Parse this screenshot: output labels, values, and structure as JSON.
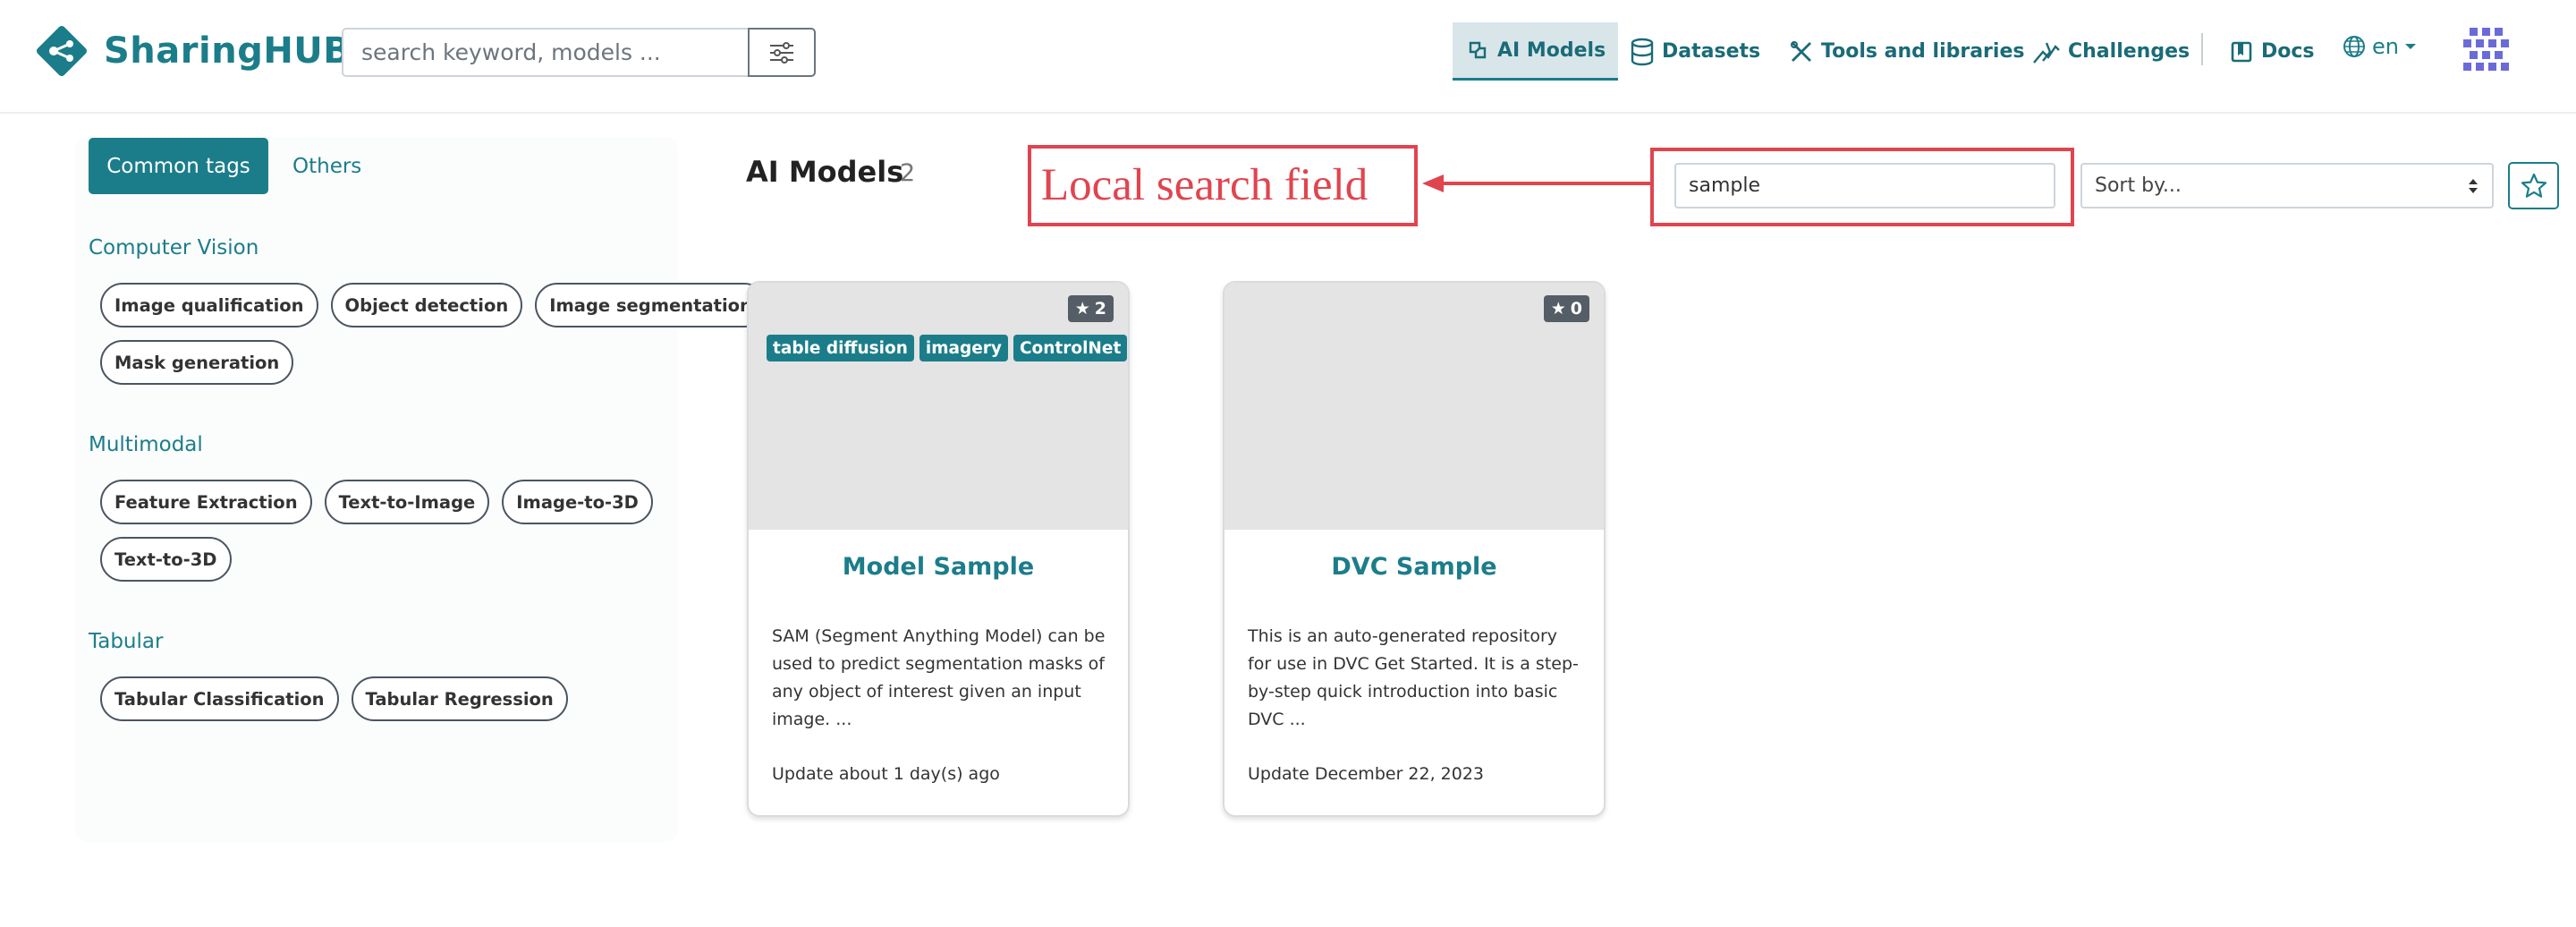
{
  "header": {
    "brand": "SharingHUB",
    "search_placeholder": "search keyword, models ...",
    "nav": {
      "ai_models": "AI Models",
      "datasets": "Datasets",
      "tools": "Tools and libraries",
      "challenges": "Challenges",
      "docs": "Docs"
    },
    "language": "en"
  },
  "sidebar": {
    "tabs": {
      "common": "Common tags",
      "others": "Others"
    },
    "categories": [
      {
        "name": "Computer Vision",
        "tags": [
          "Image qualification",
          "Object detection",
          "Image segmentation",
          "Mask generation"
        ]
      },
      {
        "name": "Multimodal",
        "tags": [
          "Feature Extraction",
          "Text-to-Image",
          "Image-to-3D",
          "Text-to-3D"
        ]
      },
      {
        "name": "Tabular",
        "tags": [
          "Tabular Classification",
          "Tabular Regression"
        ]
      }
    ]
  },
  "main": {
    "title": "AI Models",
    "count": "2",
    "annotation": "Local search field",
    "local_search_value": "sample",
    "sort_placeholder": "Sort by...",
    "cards": [
      {
        "stars": "2",
        "tags": [
          "table diffusion",
          "imagery",
          "ControlNet"
        ],
        "title": "Model Sample",
        "description": "SAM (Segment Anything Model) can be used to predict segmentation masks of any object of interest given an input image. ...",
        "updated": "Update about 1 day(s) ago"
      },
      {
        "stars": "0",
        "tags": [],
        "title": "DVC Sample",
        "description": "This is an auto-generated repository for use in DVC Get Started. It is a step-by-step quick introduction into basic DVC ...",
        "updated": "Update December 22, 2023"
      }
    ]
  },
  "colors": {
    "accent": "#1c7d8a",
    "annotation": "#e0454f",
    "card_image": "#e4e4e4"
  }
}
